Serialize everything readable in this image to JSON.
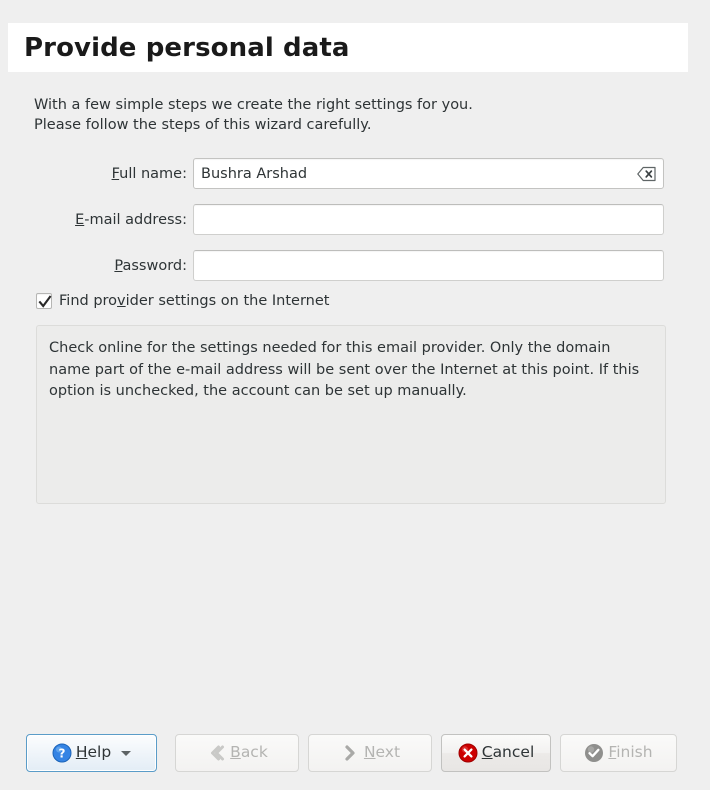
{
  "header": {
    "title": "Provide personal data"
  },
  "intro": {
    "text": "With a few simple steps we create the right settings for you.\nPlease follow the steps of this wizard carefully."
  },
  "form": {
    "fields": [
      {
        "label_pre": "",
        "label_mnemonic": "F",
        "label_post": "ull name:",
        "name": "full-name",
        "value": "Bushra Arshad",
        "placeholder": "",
        "has_clear_icon": true,
        "icon": "clear-text-icon"
      },
      {
        "label_pre": "",
        "label_mnemonic": "E",
        "label_post": "-mail address:",
        "name": "email-address",
        "value": "",
        "placeholder": "",
        "has_clear_icon": false,
        "icon": ""
      },
      {
        "label_pre": "",
        "label_mnemonic": "P",
        "label_post": "assword:",
        "name": "password",
        "value": "",
        "placeholder": "",
        "has_clear_icon": false,
        "icon": ""
      }
    ]
  },
  "checkbox": {
    "checked": true,
    "label_pre": "Find pro",
    "label_mnemonic": "v",
    "label_post": "ider settings on the Internet",
    "icon": "checkmark-icon"
  },
  "info": {
    "text": "Check online for the settings needed for this email provider. Only the domain name part of the e-mail address will be sent over the Internet at this point. If this option is unchecked, the account can be set up manually."
  },
  "buttons": {
    "help": {
      "label_pre": "",
      "label_mnemonic": "H",
      "label_post": "elp",
      "icon": "help-question-icon",
      "has_dropdown": true,
      "enabled": true
    },
    "back": {
      "label_pre": "",
      "label_mnemonic": "B",
      "label_post": "ack",
      "icon": "chevron-left-icon",
      "enabled": false
    },
    "next": {
      "label_pre": "",
      "label_mnemonic": "N",
      "label_post": "ext",
      "icon": "chevron-right-icon",
      "enabled": false
    },
    "cancel": {
      "label_pre": "",
      "label_mnemonic": "C",
      "label_post": "ancel",
      "icon": "cancel-x-icon",
      "enabled": true
    },
    "finish": {
      "label_pre": "",
      "label_mnemonic": "F",
      "label_post": "inish",
      "icon": "check-circle-icon",
      "enabled": false
    }
  },
  "colors": {
    "background": "#efefef",
    "banner": "#ffffff",
    "text": "#2e3436",
    "help_border": "#5a9cc8",
    "cancel_red": "#cc0000",
    "help_blue": "#3584e4",
    "disabled_gray": "#b4b4b2"
  }
}
